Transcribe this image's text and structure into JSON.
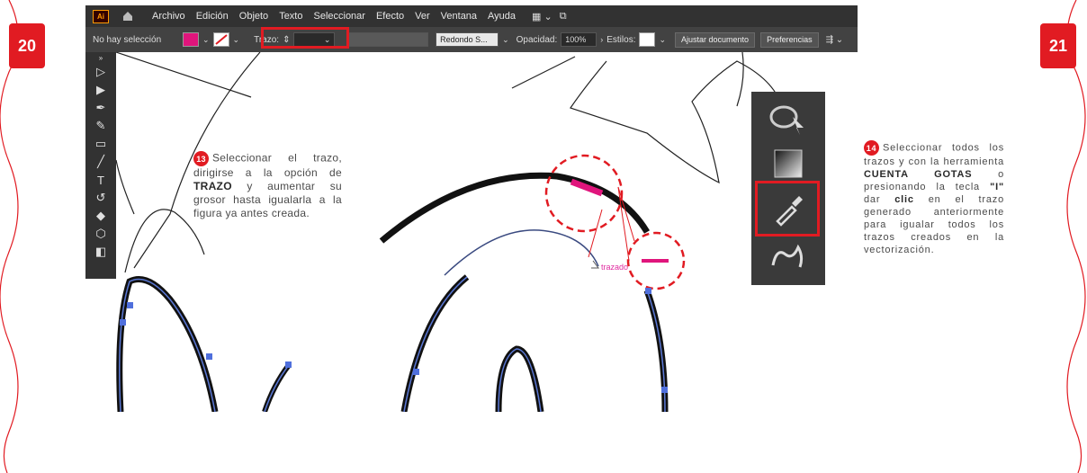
{
  "pages": {
    "left_number": "20",
    "right_number": "21"
  },
  "menubar": {
    "logo": "Ai",
    "items": [
      "Archivo",
      "Edición",
      "Objeto",
      "Texto",
      "Seleccionar",
      "Efecto",
      "Ver",
      "Ventana",
      "Ayuda"
    ]
  },
  "controlbar": {
    "selection_status": "No hay selección",
    "fill_color": "#e0157c",
    "stroke_label": "Trazo:",
    "brush": "Redondo S...",
    "opacity_label": "Opacidad:",
    "opacity_value": "100%",
    "styles_label": "Estilos:",
    "adjust_button": "Ajustar documento",
    "prefs_button": "Preferencias"
  },
  "toolbar": {
    "icons": [
      "selection-icon",
      "direct-selection-icon",
      "pen-icon",
      "curvature-icon",
      "rectangle-icon",
      "brush-icon",
      "type-icon",
      "rotate-icon",
      "eraser-icon",
      "shape-builder-icon",
      "gradient-icon"
    ]
  },
  "canvas": {
    "trazado_label": "trazado"
  },
  "step13": {
    "number": "13",
    "text_pre": "Seleccionar el trazo, dirigirse a la opción de ",
    "text_bold": "TRAZO",
    "text_post": " y aumentar su grosor hasta igualarla a la figura ya antes creada."
  },
  "step14": {
    "number": "14",
    "text_a": "Seleccionar todos los trazos y con la herramienta ",
    "text_b": "CUENTA GOTAS",
    "text_c": " o presionando la tecla ",
    "text_d": "\"I\"",
    "text_e": " dar ",
    "text_f": "clic",
    "text_g": " en el trazo generado anteriormente para igualar todos los trazos creados en la vectorización."
  },
  "colors": {
    "accent": "#e11b22",
    "magenta": "#e0157c",
    "ui_dark": "#323232"
  }
}
